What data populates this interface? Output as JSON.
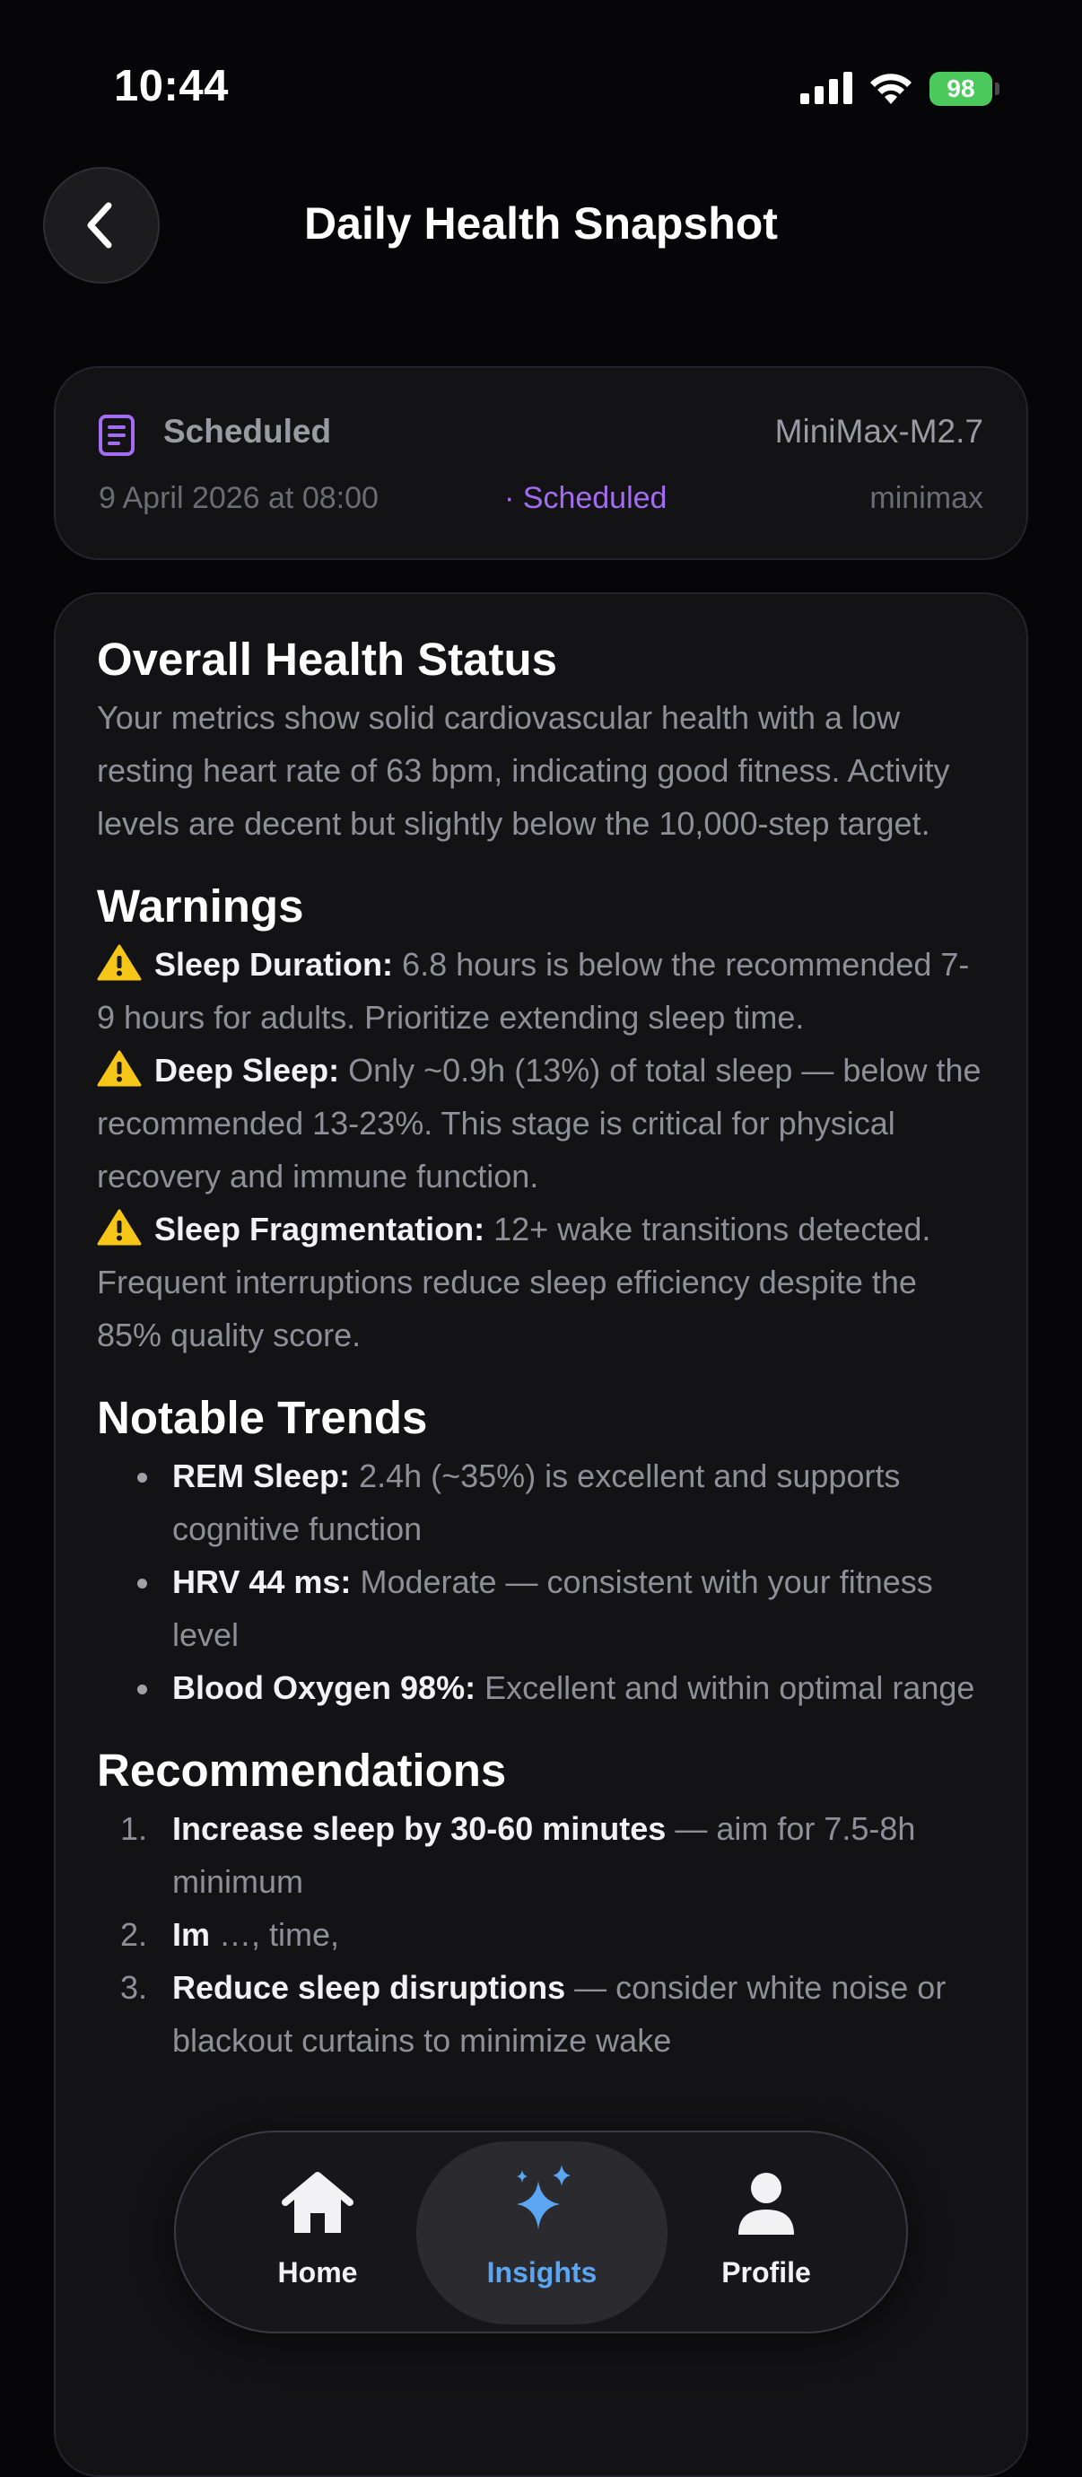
{
  "status_bar": {
    "time": "10:44",
    "battery": "98"
  },
  "header": {
    "title": "Daily Health Snapshot"
  },
  "meta": {
    "type": "Scheduled",
    "model": "MiniMax-M2.7",
    "date": "9 April 2026 at 08:00",
    "status": "· Scheduled",
    "provider": "minimax",
    "accent": "#a46cf0"
  },
  "overall": {
    "heading": "Overall Health Status",
    "text": "Your metrics show solid cardiovascular health with a low resting heart rate of 63 bpm, indicating good fitness. Activity levels are decent but slightly below the 10,000-step target."
  },
  "warnings": {
    "heading": "Warnings",
    "items": [
      {
        "icon": "warning-icon",
        "title": "Sleep Duration:",
        "text": "6.8 hours is below the recommended 7-9 hours for adults. Prioritize extending sleep time."
      },
      {
        "icon": "warning-icon",
        "title": "Deep Sleep:",
        "text": "Only ~0.9h (13%) of total sleep — below the recommended 13-23%. This stage is critical for physical recovery and immune function."
      },
      {
        "icon": "warning-icon",
        "title": "Sleep Fragmentation:",
        "text": "12+ wake transitions detected. Frequent interruptions reduce sleep efficiency despite the 85% quality score."
      }
    ]
  },
  "trends": {
    "heading": "Notable Trends",
    "items": [
      {
        "title": "REM Sleep:",
        "text": "2.4h (~35%) is excellent and supports cognitive function"
      },
      {
        "title": "HRV 44 ms:",
        "text": "Moderate — consistent with your fitness level"
      },
      {
        "title": "Blood Oxygen 98%:",
        "text": "Excellent and within optimal range"
      }
    ]
  },
  "recommendations": {
    "heading": "Recommendations",
    "items": [
      {
        "num": "1.",
        "title": "Increase sleep by 30-60 minutes",
        "text": "— aim for 7.5-8h minimum"
      },
      {
        "num": "2.",
        "title": "Im",
        "text": "…, time,"
      },
      {
        "num": "3.",
        "title": "Reduce sleep disruptions",
        "text": "— consider white noise or blackout curtains to minimize wake"
      }
    ]
  },
  "tab_bar": {
    "tabs": [
      {
        "label": "Home",
        "icon": "house-icon",
        "active": false
      },
      {
        "label": "Insights",
        "icon": "sparkles-icon",
        "active": true
      },
      {
        "label": "Profile",
        "icon": "person-icon",
        "active": false
      }
    ],
    "active_color": "#5aa6f2"
  }
}
